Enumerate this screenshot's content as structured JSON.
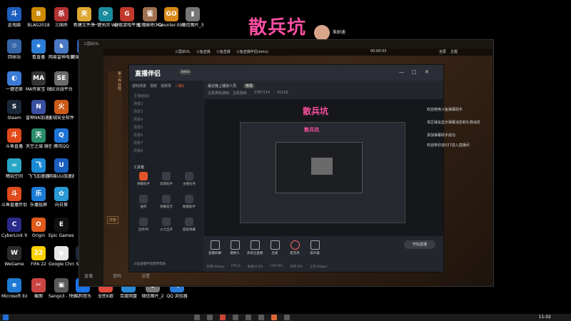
{
  "overlay_title": "散兵坑",
  "streamer": {
    "name": "朱砂迪"
  },
  "desktop_icons": [
    {
      "label": "此电脑",
      "glyph": "斗"
    },
    {
      "label": "BLAG2018",
      "glyph": "B"
    },
    {
      "label": "三国杀",
      "glyph": "杀"
    },
    {
      "label": "新建文件夹",
      "glyph": "夹"
    },
    {
      "label": "一键关闭 Window...",
      "glyph": "⟳"
    },
    {
      "label": "谷歌游戏平台",
      "glyph": "G"
    },
    {
      "label": "雀魂麻将(Mahjong...",
      "glyph": "雀"
    },
    {
      "label": "Counter-Strike Global Off...",
      "glyph": "GO"
    },
    {
      "label": "微信图片_3",
      "glyph": "▮"
    },
    {
      "label": "回收站",
      "glyph": "♲"
    },
    {
      "label": "看直播",
      "glyph": "★"
    },
    {
      "label": "网易雷神电竞平台",
      "glyph": "♞"
    },
    {
      "label": "网易UU加速器",
      "glyph": "U"
    },
    {
      "label": "一键还原",
      "glyph": "◐"
    },
    {
      "label": "MA传家宝 视频剪辑",
      "glyph": "MA"
    },
    {
      "label": "SE对战平台",
      "glyph": "SE"
    },
    {
      "label": "Steam",
      "glyph": "S"
    },
    {
      "label": "雷神NN加速器",
      "glyph": "N"
    },
    {
      "label": "火绒安全软件",
      "glyph": "火"
    },
    {
      "label": "斗鱼直播",
      "glyph": "斗"
    },
    {
      "label": "天空之城 微信视频",
      "glyph": "天"
    },
    {
      "label": "腾讯QQ",
      "glyph": "Q"
    },
    {
      "label": "畅玩空间",
      "glyph": "∞"
    },
    {
      "label": "飞飞加速器",
      "glyph": "飞"
    },
    {
      "label": "网易UU加速器",
      "glyph": "U"
    },
    {
      "label": "斗鱼直播伴侣",
      "glyph": "斗"
    },
    {
      "label": "乐播投屏",
      "glyph": "乐"
    },
    {
      "label": "向日葵",
      "glyph": "✿"
    },
    {
      "label": "CyberLink YouCam 7",
      "glyph": "C"
    },
    {
      "label": "Origin",
      "glyph": "O"
    },
    {
      "label": "Epic Games Launcher",
      "glyph": "E"
    },
    {
      "label": "WeGame",
      "glyph": "W"
    },
    {
      "label": "FIFA 22",
      "glyph": "22"
    },
    {
      "label": "Google Chrome",
      "glyph": "◉"
    },
    {
      "label": "Steam",
      "glyph": "S"
    },
    {
      "label": "Microsoft Edge",
      "glyph": "e"
    },
    {
      "label": "截图",
      "glyph": "✂"
    },
    {
      "label": "Sango3 - 快捷方式",
      "glyph": "▣"
    },
    {
      "label": "酷狗音乐",
      "glyph": "K"
    },
    {
      "label": "全民K歌",
      "glyph": "K"
    },
    {
      "label": "百度网盘",
      "glyph": "☁"
    },
    {
      "label": "微信图片_2",
      "glyph": "▮"
    },
    {
      "label": "QQ 浏览器",
      "glyph": "Q"
    }
  ],
  "game_window": {
    "title": "三国杀OL",
    "tabs": [
      "三国杀OL",
      "斗鱼直播",
      "斗鱼直播",
      "斗鱼直播伴侣(beta)"
    ],
    "timer": "00:00:03",
    "rank_label": "全屏",
    "theme_label": "主题",
    "badge_tag": "0"
  },
  "streaming_app": {
    "brand": "直播伴侣",
    "version_badge": "beta",
    "side_tabs": [
      "游戏场景",
      "视频",
      "视频录",
      "二组1"
    ],
    "scenes": [
      "主播画面1",
      "场景2",
      "场景3",
      "场景4",
      "场景5",
      "场景6",
      "场景7",
      "场景8"
    ],
    "tools_label": "工具箱",
    "tools": [
      {
        "label": "弹幕助手",
        "icon": "danmu-icon"
      },
      {
        "label": "房管助手",
        "icon": "user-icon"
      },
      {
        "label": "主播任务",
        "icon": "task-icon"
      },
      {
        "label": "抽奖",
        "icon": "gift-icon"
      },
      {
        "label": "弹幕显示",
        "icon": "chat-icon"
      },
      {
        "label": "数据助手",
        "icon": "chart-icon"
      },
      {
        "label": "全民PK",
        "icon": "pk-icon"
      },
      {
        "label": "火力全开",
        "icon": "fire-icon"
      },
      {
        "label": "超级弹幕",
        "icon": "grid-icon"
      }
    ],
    "recent_label": "最近晚上播放人员",
    "recent_btn": "修改",
    "room_info": {
      "game": "主机类热游戏 · 主机游戏",
      "room_id": "3787174",
      "fans": "41102"
    },
    "bottom_buttons": [
      "直播屏幕",
      "摄像头",
      "多机位直播",
      "连麦",
      "麦克风",
      "扬声器"
    ],
    "start_button": "开始直播",
    "footer_text": "斗鱼直播伴侣使用帮助",
    "status_items": [
      "码率:0kbps",
      "FPS:0",
      "丢帧:0.0%",
      "CPU:0%",
      "内存:0%",
      "上行:0kbps"
    ]
  },
  "bottom_controls": [
    "直播",
    "音码",
    "设置"
  ],
  "chat": {
    "lines": [
      "欢迎使用斗鱼弹幕助手",
      "本区域会显示弹幕消息和礼物消息",
      "添加弹幕助手成功",
      "欢迎朱砂迪V27进入直播间"
    ],
    "highlight_user": "朱砂迪V27"
  },
  "game_side_text": "第一界 开局",
  "game_button": "托管",
  "clock": "11:02"
}
